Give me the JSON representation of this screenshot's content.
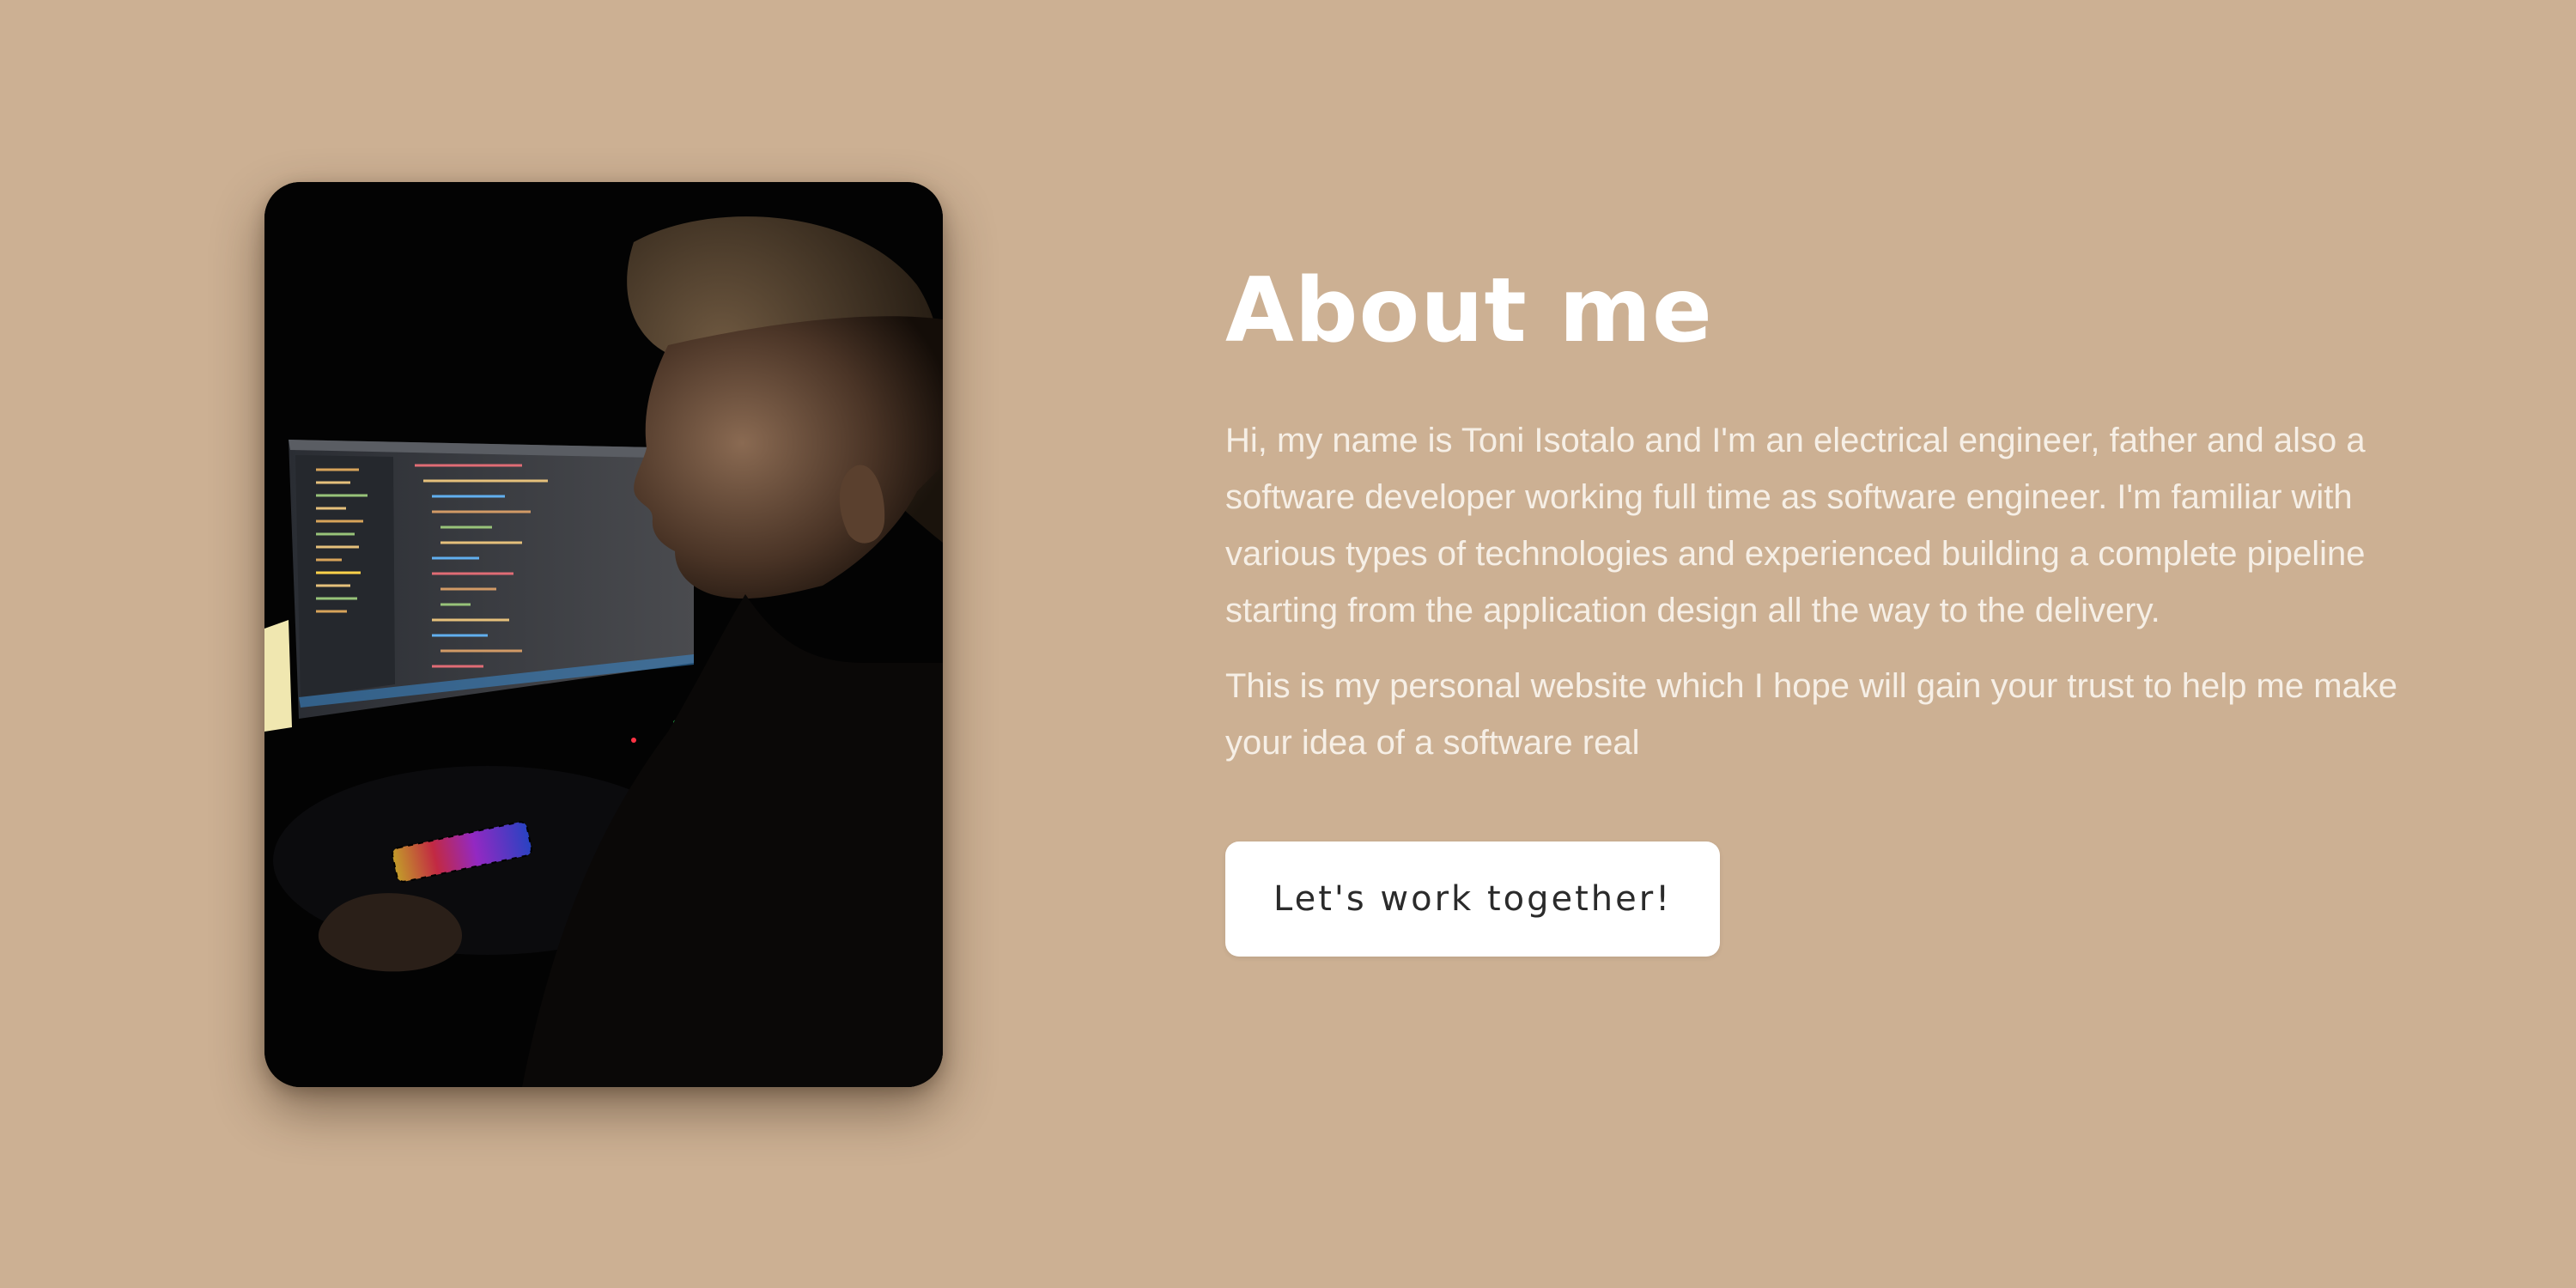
{
  "colors": {
    "page_background": "#ccb093",
    "title_text": "#ffffff",
    "body_text": "#f6efe6",
    "button_background": "#ffffff",
    "button_text": "#2b2b2b",
    "photo_background": "#030303"
  },
  "photo": {
    "icon": "portrait-photo"
  },
  "about": {
    "title": "About me",
    "paragraph_1": "Hi, my name is Toni Isotalo and I'm an electrical engineer, father and also a software developer working full time as software engineer. I'm familiar with various types of technologies and experienced building a complete pipeline starting from the application design all the way to the delivery.",
    "paragraph_2": "This is my personal website which I hope will gain your trust to help me make your idea of a software real",
    "cta_label": "Let's work together!"
  }
}
